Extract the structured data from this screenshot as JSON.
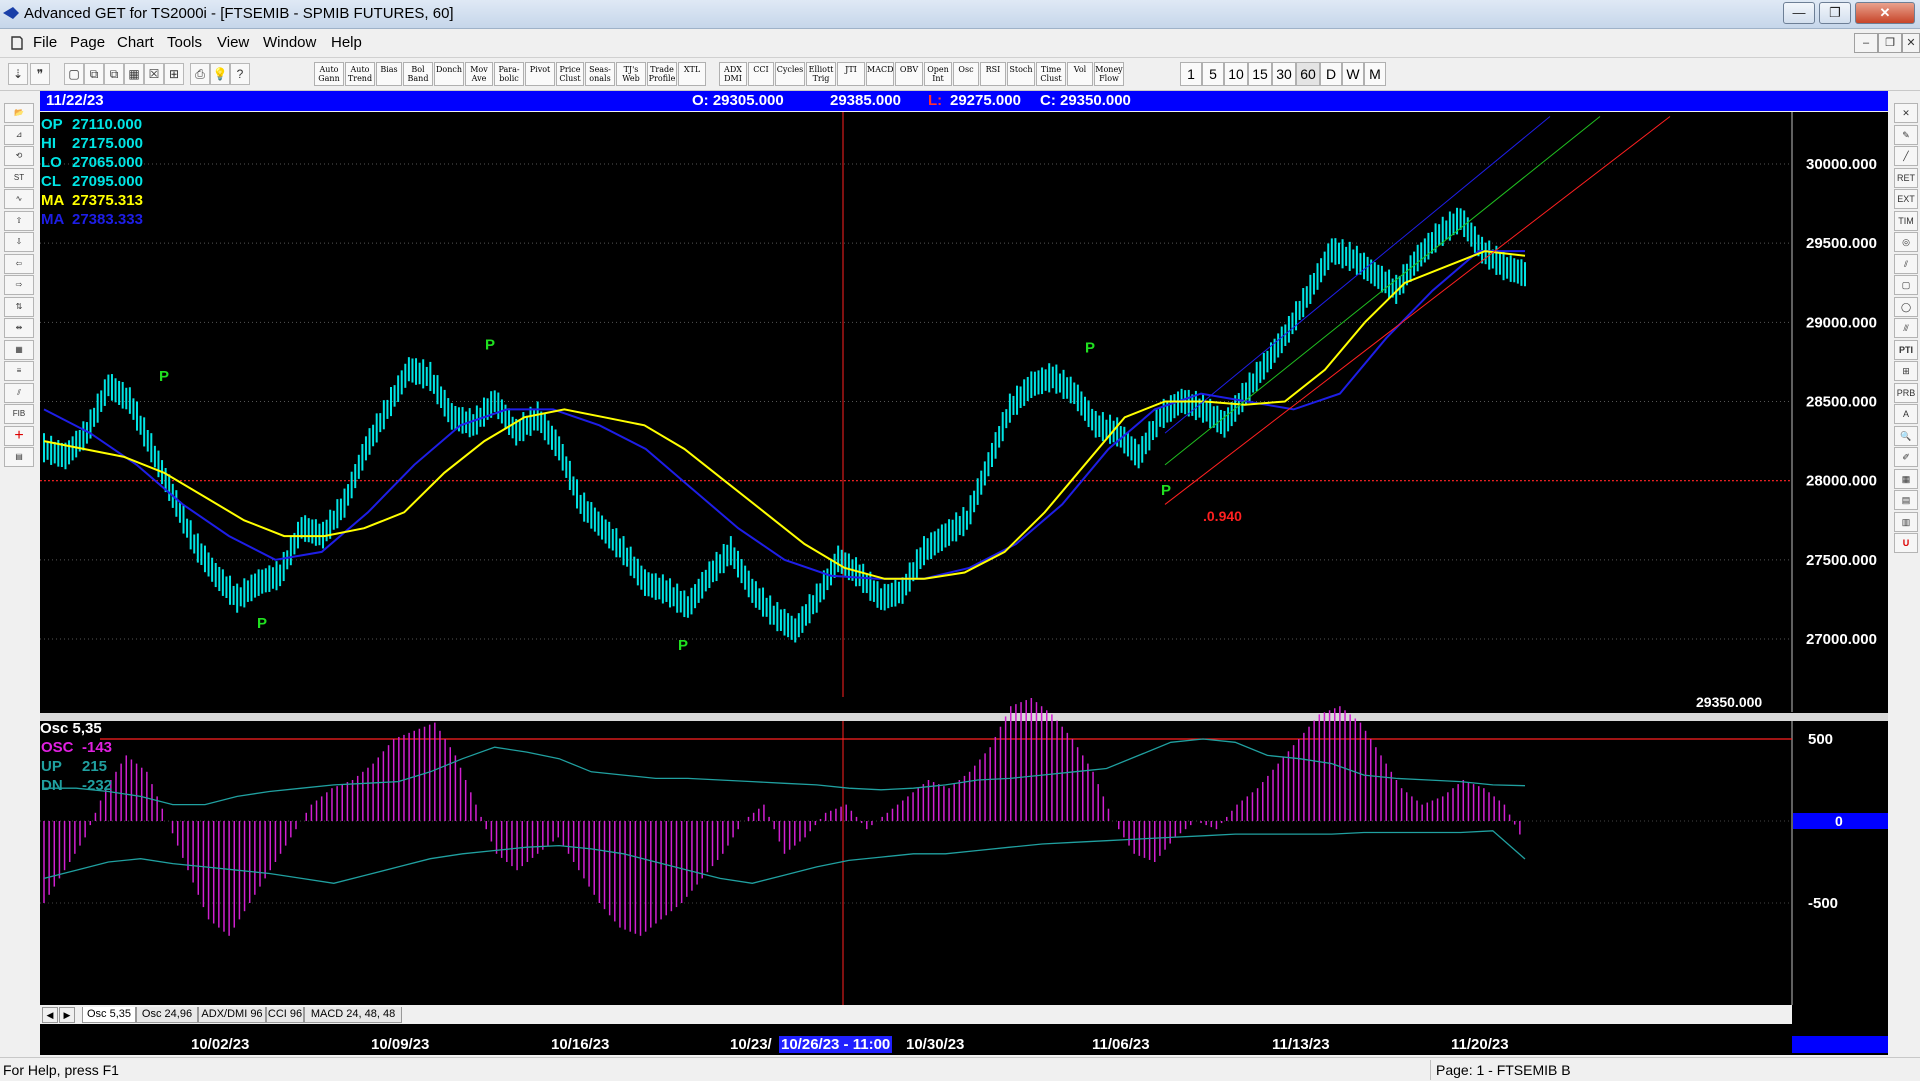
{
  "window": {
    "title": "Advanced GET for TS2000i - [FTSEMIB - SPMIB FUTURES, 60]",
    "minimize_label": "—",
    "maximize_label": "❐",
    "close_label": "✕"
  },
  "menu": [
    "File",
    "Page",
    "Chart",
    "Tools",
    "View",
    "Window",
    "Help"
  ],
  "toolbar": {
    "study_buttons": [
      "Auto Gann",
      "Auto Trend",
      "Bias",
      "Bol Band",
      "Donch",
      "Mov Ave",
      "Para-bolic",
      "Pivot",
      "Price Clust",
      "Seas-onals",
      "TJ's Web",
      "Trade Profile",
      "XTL",
      "ADX DMI",
      "CCI",
      "Cycles",
      "Elliott Trig",
      "JTI",
      "MACD",
      "OBV",
      "Open Int",
      "Osc",
      "RSI",
      "Stoch",
      "Time Clust",
      "Vol",
      "Money Flow"
    ],
    "interval_buttons": [
      "1",
      "5",
      "10",
      "15",
      "30",
      "60",
      "D",
      "W",
      "M"
    ]
  },
  "infobar": {
    "date": "11/22/23",
    "open": "O: 29305.000",
    "high": "29385.000",
    "low_label": "L:",
    "low": "29275.000",
    "close": "C: 29350.000"
  },
  "price_panel": {
    "readouts": [
      {
        "label": "OP",
        "value": "27110.000",
        "color": "#00e5e5"
      },
      {
        "label": "HI",
        "value": "27175.000",
        "color": "#00e5e5"
      },
      {
        "label": "LO",
        "value": "27065.000",
        "color": "#00e5e5"
      },
      {
        "label": "CL",
        "value": "27095.000",
        "color": "#00e5e5"
      },
      {
        "label": "MA",
        "value": "27375.313",
        "color": "#ffff00"
      },
      {
        "label": "MA",
        "value": "27383.333",
        "color": "#1e1ee6"
      }
    ],
    "y_ticks": [
      "30000.000",
      "29500.000",
      "29000.000",
      "28500.000",
      "28000.000",
      "27500.000",
      "27000.000"
    ],
    "last_price": "29350.000",
    "fib_label": ".0.940",
    "pivot_label": "P"
  },
  "osc_panel": {
    "title": "Osc 5,35",
    "readouts": [
      {
        "label": "OSC",
        "value": "-143",
        "color": "#e020e0"
      },
      {
        "label": "UP",
        "value": "215",
        "color": "#20a0a0"
      },
      {
        "label": "DN",
        "value": "-232",
        "color": "#20a0a0"
      }
    ],
    "y_ticks": [
      "500",
      "0",
      "-500"
    ],
    "zero_label": "0"
  },
  "tabs": [
    "Osc 5,35",
    "Osc 24,96",
    "ADX/DMI 96",
    "CCI 96",
    "MACD 24, 48, 48"
  ],
  "tab_nav": {
    "prev": "◀",
    "next": "▶"
  },
  "time_axis": {
    "labels": [
      "10/02/23",
      "10/09/23",
      "10/16/23",
      "10/23/",
      "10/30/23",
      "11/06/23",
      "11/13/23",
      "11/20/23"
    ],
    "cursor_label": "10/26/23 - 11:00"
  },
  "status": {
    "help": "For Help, press F1",
    "page": "Page: 1 - FTSEMIB B"
  },
  "chart_data": {
    "type": "line",
    "title": "FTSEMIB - SPMIB FUTURES, 60",
    "ylim": [
      26600,
      30300
    ],
    "x": [
      "10/02/23",
      "10/09/23",
      "10/16/23",
      "10/23/23",
      "10/30/23",
      "11/06/23",
      "11/13/23",
      "11/20/23"
    ],
    "series": [
      {
        "values": [
          28200,
          28150,
          28300,
          28600,
          28500,
          28200,
          27900,
          27600,
          27400,
          27250,
          27350,
          27400,
          27700,
          27650,
          27850,
          28200,
          28450,
          28700,
          28650,
          28400,
          28350,
          28500,
          28300,
          28400,
          28200,
          27850,
          27700,
          27550,
          27350,
          27300,
          27200,
          27400,
          27550,
          27300,
          27150,
          27050,
          27250,
          27500,
          27400,
          27250,
          27300,
          27550,
          27650,
          27750,
          28100,
          28450,
          28600,
          28650,
          28550,
          28350,
          28300,
          28150,
          28400,
          28500,
          28450,
          28350,
          28550,
          28750,
          28950,
          29200,
          29450,
          29400,
          29300,
          29200,
          29400,
          29550,
          29650,
          29450,
          29350,
          29300
        ]
      },
      {
        "values": [
          28250,
          28200,
          28150,
          28050,
          27900,
          27750,
          27650,
          27650,
          27700,
          27800,
          28050,
          28250,
          28400,
          28450,
          28400,
          28350,
          28200,
          28000,
          27800,
          27600,
          27450,
          27380,
          27380,
          27420,
          27550,
          27800,
          28100,
          28400,
          28500,
          28500,
          28480,
          28500,
          28700,
          29000,
          29250,
          29350,
          29450,
          29420
        ]
      },
      {
        "values": [
          28450,
          28300,
          28100,
          27850,
          27650,
          27500,
          27550,
          27800,
          28100,
          28350,
          28450,
          28450,
          28350,
          28200,
          27950,
          27700,
          27500,
          27400,
          27380,
          27380,
          27450,
          27600,
          27850,
          28200,
          28450,
          28550,
          28500,
          28450,
          28550,
          28900,
          29200,
          29450,
          29450
        ]
      }
    ],
    "oscillator": {
      "name": "Osc 5,35",
      "ylim": [
        -800,
        850
      ],
      "values": [
        -500,
        -300,
        -100,
        200,
        400,
        300,
        0,
        -300,
        -600,
        -700,
        -500,
        -300,
        -100,
        100,
        200,
        250,
        350,
        500,
        550,
        600,
        400,
        100,
        -200,
        -300,
        -200,
        -100,
        -300,
        -500,
        -650,
        -700,
        -600,
        -500,
        -350,
        -200,
        0,
        100,
        -200,
        -100,
        50,
        100,
        -50,
        50,
        150,
        250,
        200,
        300,
        450,
        700,
        750,
        650,
        500,
        300,
        0,
        -200,
        -250,
        -100,
        0,
        -50,
        100,
        200,
        350,
        500,
        650,
        700,
        600,
        400,
        200,
        100,
        150,
        250,
        200,
        100,
        -143
      ],
      "up": [
        200,
        200,
        180,
        150,
        100,
        100,
        150,
        180,
        200,
        220,
        230,
        240,
        300,
        380,
        450,
        420,
        380,
        300,
        280,
        260,
        260,
        250,
        240,
        230,
        220,
        200,
        190,
        200,
        220,
        250,
        260,
        280,
        300,
        320,
        400,
        480,
        500,
        480,
        400,
        380,
        350,
        280,
        260,
        250,
        240,
        220,
        215
      ],
      "dn": [
        -350,
        -300,
        -250,
        -230,
        -260,
        -280,
        -300,
        -320,
        -350,
        -380,
        -330,
        -280,
        -230,
        -200,
        -180,
        -160,
        -150,
        -170,
        -200,
        -250,
        -300,
        -350,
        -380,
        -330,
        -280,
        -240,
        -220,
        -200,
        -200,
        -180,
        -160,
        -140,
        -130,
        -120,
        -110,
        -100,
        -90,
        -80,
        -80,
        -80,
        -80,
        -70,
        -70,
        -70,
        -70,
        -60,
        -232
      ]
    }
  }
}
